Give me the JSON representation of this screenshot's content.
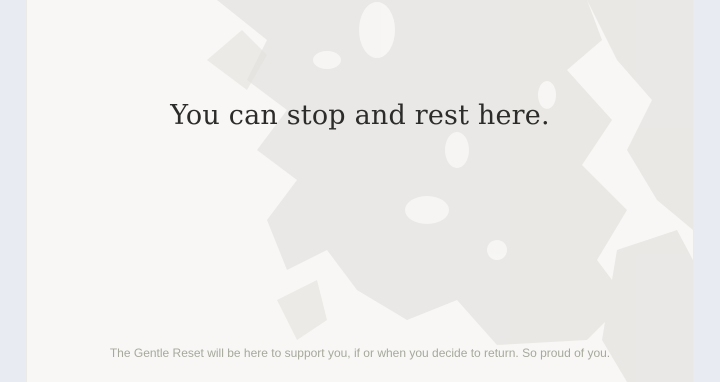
{
  "message": {
    "headline": "You can stop and rest here.",
    "note": "The Gentle Reset will be here to support you, if or when you decide to return. So proud of you."
  },
  "colors": {
    "page_background": "#e9ecf3",
    "card_background": "#f8f7f5",
    "headline_text": "#2c2c2a",
    "note_text": "#a6a99c",
    "leaf_shadow": "#d9d7d3"
  }
}
